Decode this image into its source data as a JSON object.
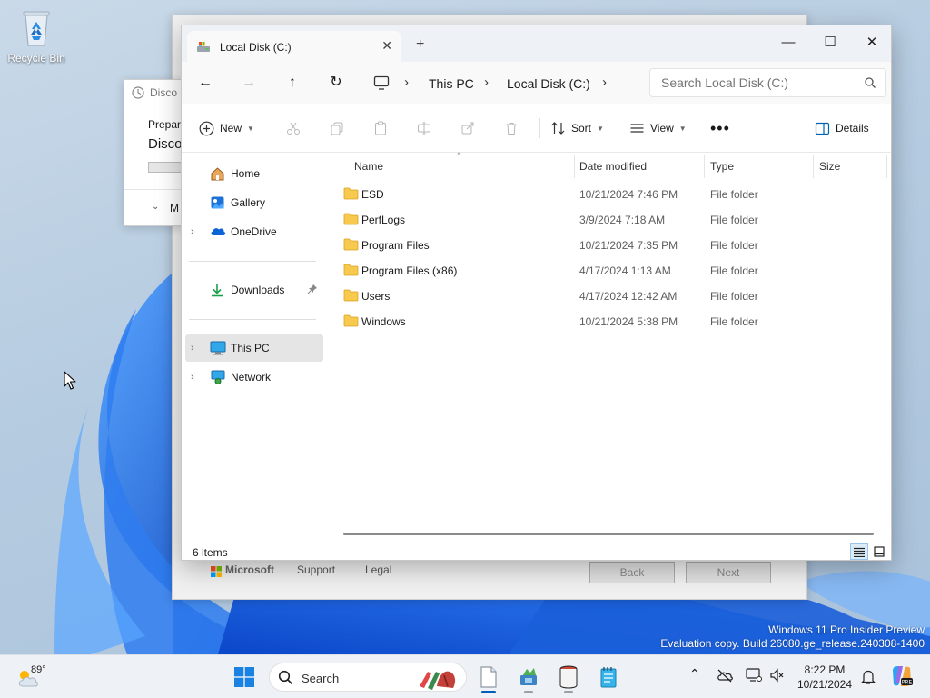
{
  "desktop": {
    "recycle_bin_label": "Recycle Bin",
    "watermark_line1": "Windows 11 Pro Insider Preview",
    "watermark_line2": "Evaluation copy. Build 26080.ge_release.240308-1400"
  },
  "setup_window": {
    "microsoft_label": "Microsoft",
    "support_label": "Support",
    "legal_label": "Legal",
    "back_label": "Back",
    "next_label": "Next"
  },
  "discover_window": {
    "title": "Disco",
    "preparing_text": "Prepari",
    "heading": "Disco",
    "more_label": "M"
  },
  "explorer": {
    "tab_title": "Local Disk (C:)",
    "breadcrumb": [
      "This PC",
      "Local Disk (C:)"
    ],
    "search_placeholder": "Search Local Disk (C:)",
    "commands": {
      "new": "New",
      "sort": "Sort",
      "view": "View",
      "details": "Details"
    },
    "nav": {
      "home": "Home",
      "gallery": "Gallery",
      "onedrive": "OneDrive",
      "downloads": "Downloads",
      "this_pc": "This PC",
      "network": "Network"
    },
    "columns": {
      "name": "Name",
      "date": "Date modified",
      "type": "Type",
      "size": "Size"
    },
    "files": [
      {
        "name": "ESD",
        "date": "10/21/2024 7:46 PM",
        "type": "File folder"
      },
      {
        "name": "PerfLogs",
        "date": "3/9/2024 7:18 AM",
        "type": "File folder"
      },
      {
        "name": "Program Files",
        "date": "10/21/2024 7:35 PM",
        "type": "File folder"
      },
      {
        "name": "Program Files (x86)",
        "date": "4/17/2024 1:13 AM",
        "type": "File folder"
      },
      {
        "name": "Users",
        "date": "4/17/2024 12:42 AM",
        "type": "File folder"
      },
      {
        "name": "Windows",
        "date": "10/21/2024 5:38 PM",
        "type": "File folder"
      }
    ],
    "status": {
      "item_count": "6 items"
    }
  },
  "taskbar": {
    "weather_temp": "89°",
    "search_label": "Search",
    "time": "8:22 PM",
    "date": "10/21/2024"
  },
  "colors": {
    "accent": "#005fb8",
    "folder": "#f8c94f",
    "wallpaper_blue": "#1f6ee8"
  }
}
